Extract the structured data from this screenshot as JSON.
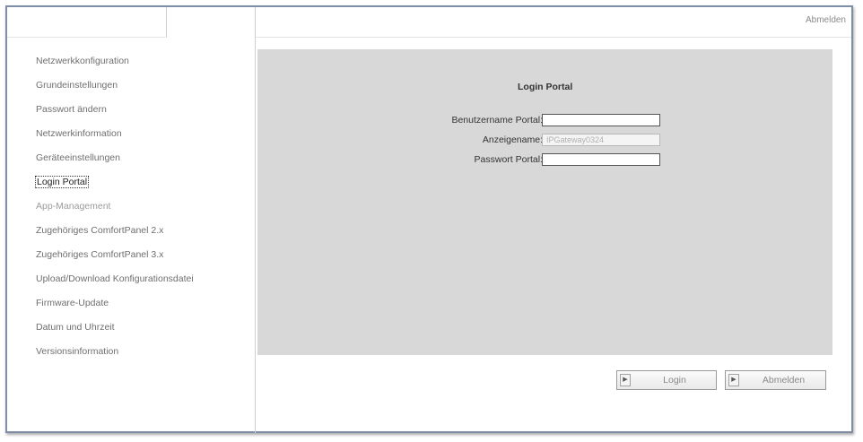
{
  "header": {
    "logout_link": "Abmelden"
  },
  "sidebar": {
    "items": [
      {
        "label": "Netzwerkkonfiguration"
      },
      {
        "label": "Grundeinstellungen"
      },
      {
        "label": "Passwort ändern"
      },
      {
        "label": "Netzwerkinformation"
      },
      {
        "label": "Geräteeinstellungen"
      },
      {
        "label": "Login Portal"
      },
      {
        "label": "App-Management"
      },
      {
        "label": "Zugehöriges ComfortPanel 2.x"
      },
      {
        "label": "Zugehöriges ComfortPanel 3.x"
      },
      {
        "label": "Upload/Download Konfigurationsdatei"
      },
      {
        "label": "Firmware-Update"
      },
      {
        "label": "Datum und Uhrzeit"
      },
      {
        "label": "Versionsinformation"
      }
    ],
    "active_item": "Login Portal"
  },
  "form": {
    "title": "Login Portal",
    "username_label": "Benutzername Portal:",
    "username_value": "",
    "displayname_label": "Anzeigename:",
    "displayname_value": "IPGateway0324",
    "password_label": "Passwort Portal:",
    "password_value": ""
  },
  "buttons": {
    "login_label": "Login",
    "logout_label": "Abmelden",
    "arrow_glyph": "▶"
  }
}
